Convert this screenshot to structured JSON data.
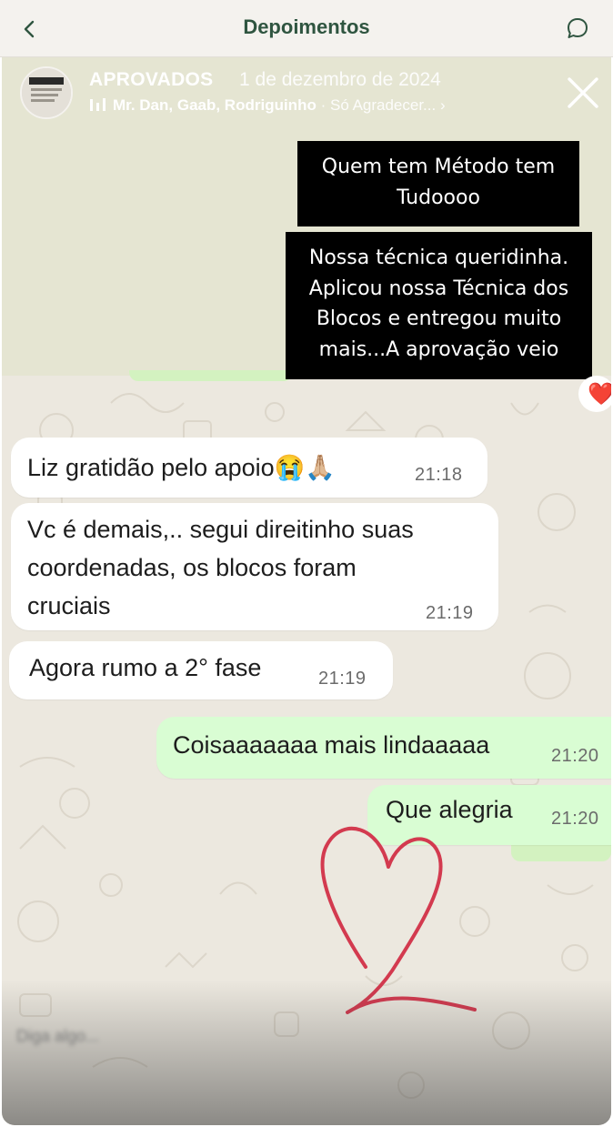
{
  "header": {
    "title": "Depoimentos"
  },
  "story": {
    "user": "APROVADOS",
    "date": "1 de dezembro de 2024",
    "music": {
      "artists": "Mr. Dan, Gaab, Rodriguinho",
      "separator": "·",
      "song": "Só Agradecer... ›"
    },
    "captions": [
      "Quem tem Método tem Tudoooo",
      "Nossa técnica queridinha. Aplicou nossa Técnica dos Blocos  e entregou muito mais...A aprovação veio"
    ],
    "reply_placeholder": "Diga algo..."
  },
  "chat": {
    "messages": [
      {
        "direction": "in",
        "text": "Liz gratidão pelo apoio😭🙏🏼",
        "time": "21:18"
      },
      {
        "direction": "in",
        "text": [
          "Vc é demais,.. segui direitinho suas",
          "coordenadas, os blocos foram",
          "cruciais"
        ],
        "time": "21:19"
      },
      {
        "direction": "in",
        "text": "Agora rumo a 2° fase",
        "time": "21:19"
      },
      {
        "direction": "out",
        "text": "Coisaaaaaaa mais lindaaaaa",
        "time": "21:20"
      },
      {
        "direction": "out",
        "text": "Que alegria",
        "time": "21:20"
      }
    ],
    "reaction_emoji": "❤️"
  },
  "colors": {
    "title_green": "#2f5540",
    "incoming_bubble": "#ffffff",
    "outgoing_bubble": "#d9fdd3",
    "drawn_heart": "#d33a4f",
    "caption_bg": "#000000"
  },
  "icons": {
    "back": "chevron-left-icon",
    "chat": "chat-bubble-icon",
    "close": "close-icon",
    "music": "music-bars-icon",
    "drawn_heart": "heart-drawing"
  }
}
